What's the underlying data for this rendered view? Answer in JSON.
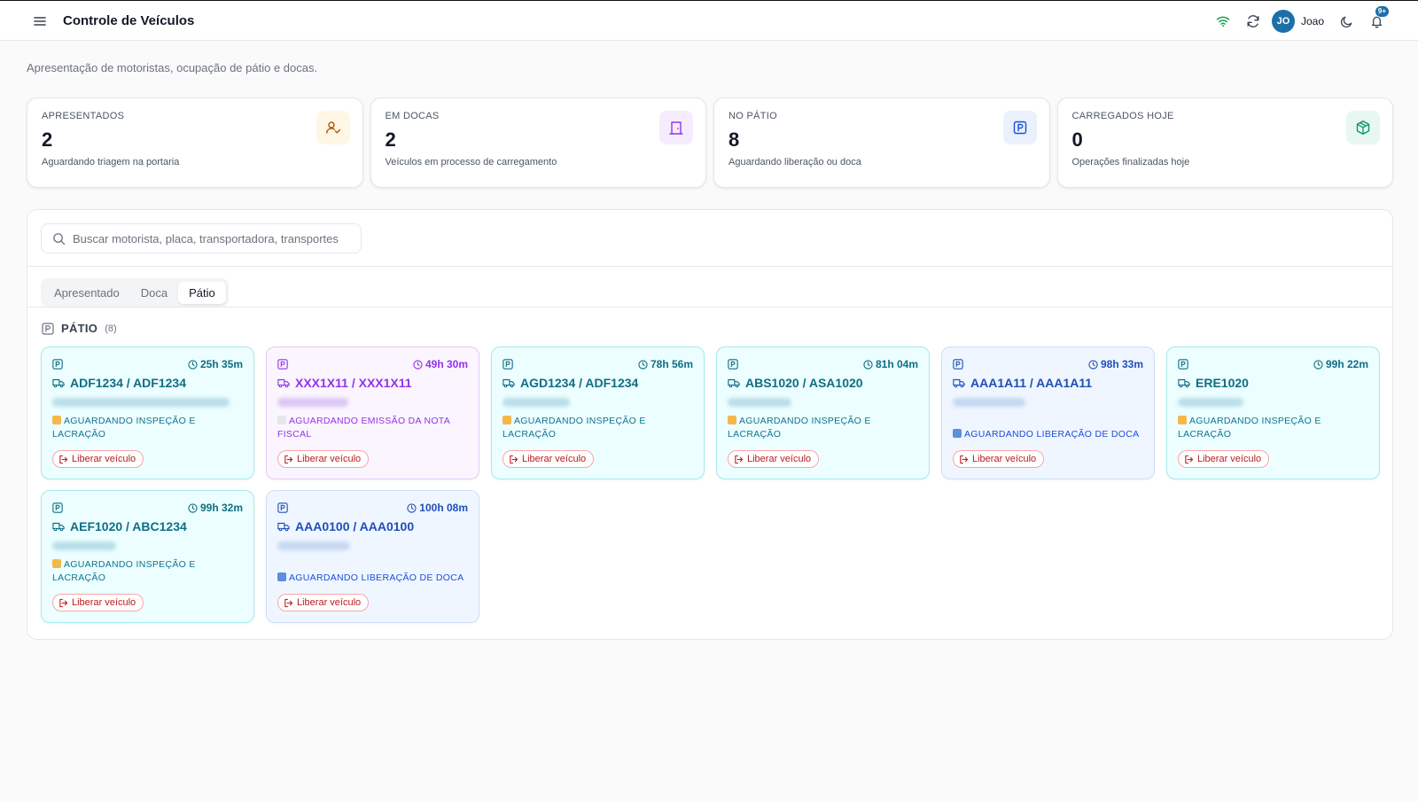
{
  "header": {
    "title": "Controle de Veículos",
    "user_initials": "JO",
    "user_name": "Joao",
    "notification_count": "9+"
  },
  "subtitle": "Apresentação de motoristas, ocupação de pátio e docas.",
  "stats": [
    {
      "label": "APRESENTADOS",
      "value": "2",
      "desc": "Aguardando triagem na portaria",
      "icon": "user-check-icon",
      "color": "#b45309",
      "bg": "#fef7e6"
    },
    {
      "label": "EM DOCAS",
      "value": "2",
      "desc": "Veículos em processo de carregamento",
      "icon": "dock-door-icon",
      "color": "#9333ea",
      "bg": "#f5edfd"
    },
    {
      "label": "NO PÁTIO",
      "value": "8",
      "desc": "Aguardando liberação ou doca",
      "icon": "parking-icon",
      "color": "#1d4ed8",
      "bg": "#eaf1fd"
    },
    {
      "label": "CARREGADOS HOJE",
      "value": "0",
      "desc": "Operações finalizadas hoje",
      "icon": "package-icon",
      "color": "#059669",
      "bg": "#e8f8f1"
    }
  ],
  "search": {
    "placeholder": "Buscar motorista, placa, transportadora, transportes",
    "value": ""
  },
  "tabs": [
    {
      "label": "Apresentado",
      "active": false
    },
    {
      "label": "Doca",
      "active": false
    },
    {
      "label": "Pátio",
      "active": true
    }
  ],
  "section": {
    "title": "PÁTIO",
    "count": "(8)"
  },
  "release_label": "Liberar veículo",
  "vehicles": [
    {
      "time": "25h 35m",
      "plate": "ADF1234 / ADF1234",
      "status": "AGUARDANDO INSPEÇÃO E LACRAÇÃO",
      "theme": "teal"
    },
    {
      "time": "49h 30m",
      "plate": "XXX1X11 / XXX1X11",
      "status": "AGUARDANDO EMISSÃO DA NOTA FISCAL",
      "theme": "purple"
    },
    {
      "time": "78h 56m",
      "plate": "AGD1234 / ADF1234",
      "status": "AGUARDANDO INSPEÇÃO E LACRAÇÃO",
      "theme": "teal"
    },
    {
      "time": "81h 04m",
      "plate": "ABS1020 / ASA1020",
      "status": "AGUARDANDO INSPEÇÃO E LACRAÇÃO",
      "theme": "teal"
    },
    {
      "time": "98h 33m",
      "plate": "AAA1A11 / AAA1A11",
      "status": "AGUARDANDO LIBERAÇÃO DE DOCA",
      "theme": "blue"
    },
    {
      "time": "99h 22m",
      "plate": "ERE1020",
      "status": "AGUARDANDO INSPEÇÃO E LACRAÇÃO",
      "theme": "teal"
    },
    {
      "time": "99h 32m",
      "plate": "AEF1020 / ABC1234",
      "status": "AGUARDANDO INSPEÇÃO E LACRAÇÃO",
      "theme": "teal"
    },
    {
      "time": "100h 08m",
      "plate": "AAA0100 / AAA0100",
      "status": "AGUARDANDO LIBERAÇÃO DE DOCA",
      "theme": "blue"
    }
  ]
}
